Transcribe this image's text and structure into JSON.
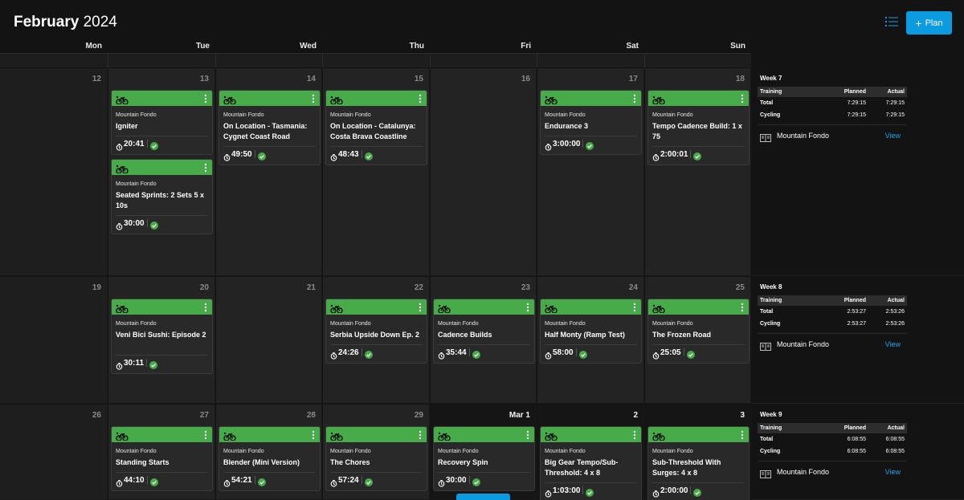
{
  "header": {
    "month": "February",
    "year": "2024",
    "plan_button": "Plan",
    "list_icon": "list-icon",
    "plus_icon": "plus-icon"
  },
  "weekdays": [
    "Mon",
    "Tue",
    "Wed",
    "Thu",
    "Fri",
    "Sat",
    "Sun"
  ],
  "colors": {
    "accent": "#0b9be0",
    "workout_bar": "#46ab48",
    "complete_check": "#46ab48",
    "link": "#17a4e8"
  },
  "icons": {
    "workout": "bike-icon",
    "menu": "kebab-icon",
    "duration": "clock-icon",
    "status": "check-icon",
    "plan": "book-icon"
  },
  "weeks": [
    {
      "days": [
        {
          "label": "12",
          "workouts": []
        },
        {
          "label": "13",
          "workouts": [
            {
              "plan": "Mountain Fondo",
              "title": "Igniter",
              "duration": "20:41"
            },
            {
              "plan": "Mountain Fondo",
              "title": "Seated Sprints: 2 Sets 5 x 10s",
              "duration": "30:00"
            }
          ]
        },
        {
          "label": "14",
          "workouts": [
            {
              "plan": "Mountain Fondo",
              "title": "On Location - Tasmania: Cygnet Coast Road",
              "duration": "49:50"
            }
          ]
        },
        {
          "label": "15",
          "workouts": [
            {
              "plan": "Mountain Fondo",
              "title": "On Location - Catalunya: Costa Brava Coastline",
              "duration": "48:43"
            }
          ]
        },
        {
          "label": "16",
          "workouts": []
        },
        {
          "label": "17",
          "workouts": [
            {
              "plan": "Mountain Fondo",
              "title": "Endurance 3",
              "duration": "3:00:00"
            }
          ]
        },
        {
          "label": "18",
          "workouts": [
            {
              "plan": "Mountain Fondo",
              "title": "Tempo Cadence Build: 1 x 75",
              "duration": "2:00:01"
            }
          ]
        }
      ],
      "summary": {
        "week": "Week 7",
        "headers": [
          "Training",
          "Planned",
          "Actual"
        ],
        "rows": [
          [
            "Total",
            "7:29:15",
            "7:29:15"
          ],
          [
            "Cycling",
            "7:29:15",
            "7:29:15"
          ]
        ],
        "plan": "Mountain Fondo",
        "view": "View"
      }
    },
    {
      "days": [
        {
          "label": "19",
          "workouts": []
        },
        {
          "label": "20",
          "workouts": [
            {
              "plan": "Mountain Fondo",
              "title": "Veni Bici Sushi: Episode 2",
              "duration": "30:11"
            }
          ]
        },
        {
          "label": "21",
          "workouts": []
        },
        {
          "label": "22",
          "workouts": [
            {
              "plan": "Mountain Fondo",
              "title": "Serbia Upside Down Ep. 2",
              "duration": "24:26"
            }
          ]
        },
        {
          "label": "23",
          "workouts": [
            {
              "plan": "Mountain Fondo",
              "title": "Cadence Builds",
              "duration": "35:44"
            }
          ]
        },
        {
          "label": "24",
          "workouts": [
            {
              "plan": "Mountain Fondo",
              "title": "Half Monty (Ramp Test)",
              "duration": "58:00"
            }
          ]
        },
        {
          "label": "25",
          "workouts": [
            {
              "plan": "Mountain Fondo",
              "title": "The Frozen Road",
              "duration": "25:05"
            }
          ]
        }
      ],
      "summary": {
        "week": "Week 8",
        "headers": [
          "Training",
          "Planned",
          "Actual"
        ],
        "rows": [
          [
            "Total",
            "2:53:27",
            "2:53:26"
          ],
          [
            "Cycling",
            "2:53:27",
            "2:53:26"
          ]
        ],
        "plan": "Mountain Fondo",
        "view": "View"
      }
    },
    {
      "days": [
        {
          "label": "26",
          "workouts": []
        },
        {
          "label": "27",
          "workouts": [
            {
              "plan": "Mountain Fondo",
              "title": "Standing Starts",
              "duration": "44:10"
            }
          ]
        },
        {
          "label": "28",
          "workouts": [
            {
              "plan": "Mountain Fondo",
              "title": "Blender (Mini Version)",
              "duration": "54:21"
            }
          ]
        },
        {
          "label": "29",
          "workouts": [
            {
              "plan": "Mountain Fondo",
              "title": "The Chores",
              "duration": "57:24"
            }
          ]
        },
        {
          "label": "Mar 1",
          "workouts": [
            {
              "plan": "Mountain Fondo",
              "title": "Recovery Spin",
              "duration": "30:00"
            }
          ]
        },
        {
          "label": "2",
          "workouts": [
            {
              "plan": "Mountain Fondo",
              "title": "Big Gear Tempo/Sub-Threshold: 4 x 8",
              "duration": "1:03:00"
            }
          ]
        },
        {
          "label": "3",
          "workouts": [
            {
              "plan": "Mountain Fondo",
              "title": "Sub-Threshold With Surges: 4 x 8",
              "duration": "2:00:00"
            }
          ]
        }
      ],
      "summary": {
        "week": "Week 9",
        "headers": [
          "Training",
          "Planned",
          "Actual"
        ],
        "rows": [
          [
            "Total",
            "6:08:55",
            "6:08:55"
          ],
          [
            "Cycling",
            "6:08:55",
            "6:08:55"
          ]
        ],
        "plan": "Mountain Fondo",
        "view": "View"
      }
    }
  ]
}
